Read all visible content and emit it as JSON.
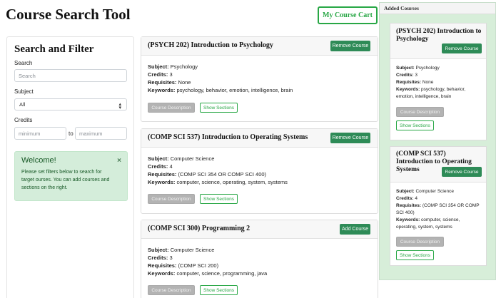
{
  "app": {
    "title": "Course Search Tool",
    "cart_button": "My Course Cart"
  },
  "filter": {
    "title": "Search and Filter",
    "search_label": "Search",
    "search_placeholder": "Search",
    "subject_label": "Subject",
    "subject_value": "All",
    "credits_label": "Credits",
    "min_placeholder": "minimum",
    "to_label": "to",
    "max_placeholder": "maximum"
  },
  "welcome": {
    "title": "Welcome!",
    "close": "×",
    "text": "Please set filters below to search for target ourses. You can add courses and sections on the right."
  },
  "labels": {
    "subject": "Subject:",
    "credits": "Credits:",
    "requisites": "Requisites:",
    "keywords": "Keywords:",
    "course_description": "Course Description",
    "show_sections": "Show Sections"
  },
  "courses": [
    {
      "title": "(PSYCH 202) Introduction to Psychology",
      "action": "Remove Course",
      "subject": "Psychology",
      "credits": "3",
      "requisites": "None",
      "keywords": "psychology, behavior, emotion, intelligence, brain"
    },
    {
      "title": "(COMP SCI 537) Introduction to Operating Systems",
      "action": "Remove Course",
      "subject": "Computer Science",
      "credits": "4",
      "requisites": "(COMP SCI 354 OR COMP SCI 400)",
      "keywords": "computer, science, operating, system, systems"
    },
    {
      "title": "(COMP SCI 300) Programming 2",
      "action": "Add Course",
      "subject": "Computer Science",
      "credits": "3",
      "requisites": "(COMP SCI 200)",
      "keywords": "computer, science, programming, java"
    }
  ],
  "cart": {
    "header": "Added Courses",
    "items": [
      {
        "title": "(PSYCH 202) Introduction to Psychology",
        "action": "Remove Course",
        "subject": "Psychology",
        "credits": "3",
        "requisites": "None",
        "keywords": "psychology, behavior, emotion, intelligence, brain"
      },
      {
        "title": "(COMP SCI 537) Introduction to Operating Systems",
        "action": "Remove Course",
        "subject": "Computer Science",
        "credits": "4",
        "requisites": "(COMP SCI 354 OR COMP SCI 400)",
        "keywords": "computer, science, operating, system, systems"
      }
    ]
  },
  "colors": {
    "accent": "#2e8b57",
    "success": "#28a745",
    "alert_bg": "#d4edda",
    "cart_bg": "#d7eed9"
  }
}
